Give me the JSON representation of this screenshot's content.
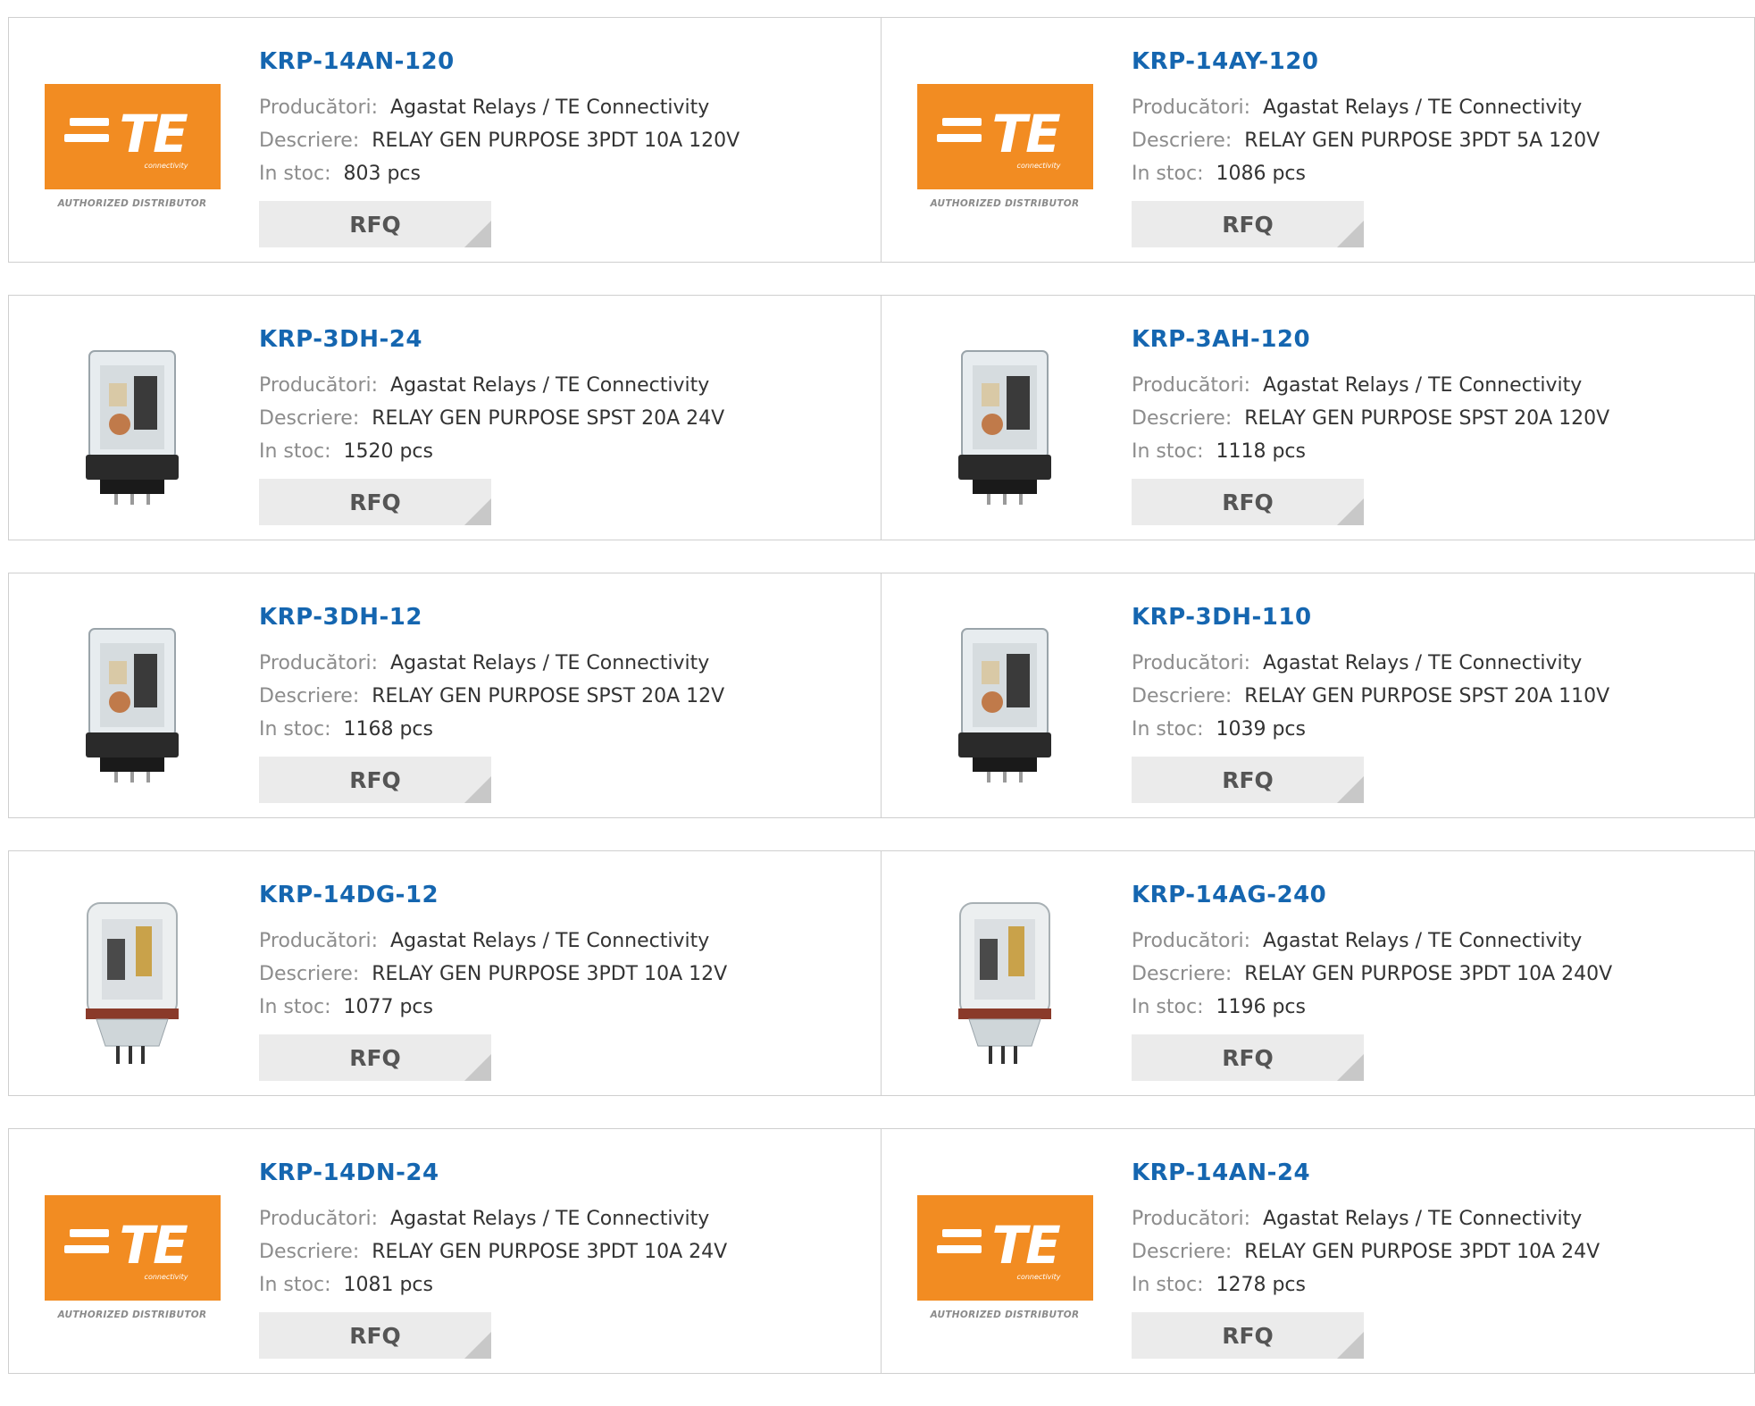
{
  "labels": {
    "manufacturer": "Producători:",
    "description": "Descriere:",
    "stock": "In stoc:",
    "rfq": "RFQ"
  },
  "logo": {
    "word": "TE",
    "sub": "connectivity",
    "authorized": "AUTHORIZED DISTRIBUTOR"
  },
  "colors": {
    "title": "#1566b0",
    "label": "#8c8c8c",
    "logo_orange": "#f28c22",
    "rfq_bg": "#ebebeb"
  },
  "products": [
    {
      "part": "KRP-14AN-120",
      "manufacturer": "Agastat Relays / TE Connectivity",
      "description": "RELAY GEN PURPOSE 3PDT 10A 120V",
      "stock": "803 pcs",
      "image": "te-logo"
    },
    {
      "part": "KRP-14AY-120",
      "manufacturer": "Agastat Relays / TE Connectivity",
      "description": "RELAY GEN PURPOSE 3PDT 5A 120V",
      "stock": "1086 pcs",
      "image": "te-logo"
    },
    {
      "part": "KRP-3DH-24",
      "manufacturer": "Agastat Relays / TE Connectivity",
      "description": "RELAY GEN PURPOSE SPST 20A 24V",
      "stock": "1520 pcs",
      "image": "relay-square"
    },
    {
      "part": "KRP-3AH-120",
      "manufacturer": "Agastat Relays / TE Connectivity",
      "description": "RELAY GEN PURPOSE SPST 20A 120V",
      "stock": "1118 pcs",
      "image": "relay-square"
    },
    {
      "part": "KRP-3DH-12",
      "manufacturer": "Agastat Relays / TE Connectivity",
      "description": "RELAY GEN PURPOSE SPST 20A 12V",
      "stock": "1168 pcs",
      "image": "relay-square"
    },
    {
      "part": "KRP-3DH-110",
      "manufacturer": "Agastat Relays / TE Connectivity",
      "description": "RELAY GEN PURPOSE SPST 20A 110V",
      "stock": "1039 pcs",
      "image": "relay-square"
    },
    {
      "part": "KRP-14DG-12",
      "manufacturer": "Agastat Relays / TE Connectivity",
      "description": "RELAY GEN PURPOSE 3PDT 10A 12V",
      "stock": "1077 pcs",
      "image": "relay-round"
    },
    {
      "part": "KRP-14AG-240",
      "manufacturer": "Agastat Relays / TE Connectivity",
      "description": "RELAY GEN PURPOSE 3PDT 10A 240V",
      "stock": "1196 pcs",
      "image": "relay-round"
    },
    {
      "part": "KRP-14DN-24",
      "manufacturer": "Agastat Relays / TE Connectivity",
      "description": "RELAY GEN PURPOSE 3PDT 10A 24V",
      "stock": "1081 pcs",
      "image": "te-logo"
    },
    {
      "part": "KRP-14AN-24",
      "manufacturer": "Agastat Relays / TE Connectivity",
      "description": "RELAY GEN PURPOSE 3PDT 10A 24V",
      "stock": "1278 pcs",
      "image": "te-logo"
    }
  ]
}
